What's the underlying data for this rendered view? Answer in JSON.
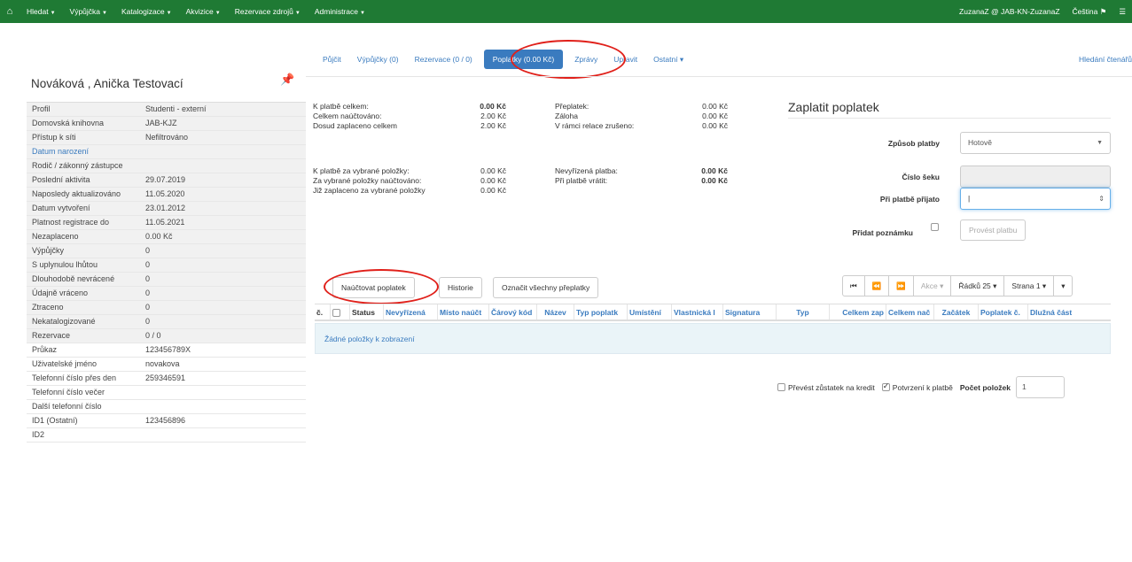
{
  "topnav": {
    "home_icon": "home-icon",
    "items": [
      "Hledat",
      "Výpůjčka",
      "Katalogizace",
      "Akvizice",
      "Rezervace zdrojů",
      "Administrace"
    ],
    "user": "ZuzanaZ @ JAB-KN-ZuzanaZ",
    "language": "Čeština",
    "menu_icon": "menu-icon"
  },
  "patron": {
    "name": "Nováková , Anička Testovací",
    "rows": [
      {
        "k": "Profil",
        "v": "Studenti - externí"
      },
      {
        "k": "Domovská knihovna",
        "v": "JAB-KJZ"
      },
      {
        "k": "Přístup k síti",
        "v": "Nefiltrováno"
      },
      {
        "k": "Datum narození",
        "v": ""
      },
      {
        "k": "Rodič / zákonný zástupce",
        "v": ""
      },
      {
        "k": "Poslední aktivita",
        "v": "29.07.2019"
      },
      {
        "k": "Naposledy aktualizováno",
        "v": "11.05.2020"
      },
      {
        "k": "Datum vytvoření",
        "v": "23.01.2012"
      },
      {
        "k": "Platnost registrace do",
        "v": "11.05.2021"
      },
      {
        "k": "Nezaplaceno",
        "v": "0.00 Kč"
      },
      {
        "k": "Výpůjčky",
        "v": "0"
      },
      {
        "k": "S uplynulou lhůtou",
        "v": "0"
      },
      {
        "k": "Dlouhodobě nevrácené",
        "v": "0"
      },
      {
        "k": "Údajně vráceno",
        "v": "0"
      },
      {
        "k": "Ztraceno",
        "v": "0"
      },
      {
        "k": "Nekatalogizované",
        "v": "0"
      },
      {
        "k": "Rezervace",
        "v": "0 / 0"
      },
      {
        "k": "Průkaz",
        "v": "123456789X"
      },
      {
        "k": "Uživatelské jméno",
        "v": "novakova"
      },
      {
        "k": "Telefonní číslo přes den",
        "v": "259346591"
      },
      {
        "k": "Telefonní číslo večer",
        "v": ""
      },
      {
        "k": "Další telefonní číslo",
        "v": ""
      },
      {
        "k": "ID1 (Ostatní)",
        "v": "123456896"
      },
      {
        "k": "ID2",
        "v": ""
      }
    ]
  },
  "tabs": {
    "items": [
      "Půjčit",
      "Výpůjčky (0)",
      "Rezervace (0 / 0)",
      "Poplatky (0.00 Kč)",
      "Zprávy",
      "Upravit",
      "Ostatní"
    ],
    "search": "Hledání čtenářů"
  },
  "summary": {
    "top_left": [
      {
        "lbl": "K platbě celkem:",
        "val": "0.00 Kč"
      },
      {
        "lbl": "Celkem naúčtováno:",
        "val": "2.00 Kč"
      },
      {
        "lbl": "Dosud zaplaceno celkem",
        "val": "2.00 Kč"
      }
    ],
    "top_right": [
      {
        "lbl": "Přeplatek:",
        "val": "0.00 Kč"
      },
      {
        "lbl": "Záloha",
        "val": "0.00 Kč"
      },
      {
        "lbl": "V rámci relace zrušeno:",
        "val": "0.00 Kč"
      }
    ],
    "bottom_left": [
      {
        "lbl": "K platbě za vybrané položky:",
        "val": "0.00 Kč"
      },
      {
        "lbl": "Za vybrané položky naúčtováno:",
        "val": "0.00 Kč"
      },
      {
        "lbl": "Již zaplaceno za vybrané položky",
        "val": "0.00 Kč"
      }
    ],
    "bottom_right": [
      {
        "lbl": "Nevyřízená platba:",
        "val": "0.00 Kč"
      },
      {
        "lbl": "Při platbě vrátit:",
        "val": "0.00 Kč"
      }
    ]
  },
  "pay": {
    "title": "Zaplatit poplatek",
    "method_label": "Způsob platby",
    "method_value": "Hotově",
    "check_label": "Číslo šeku",
    "received_label": "Při platbě přijato",
    "note_label": "Přidat poznámku",
    "submit": "Provést platbu"
  },
  "actions": {
    "charge": "Naúčtovat poplatek",
    "history": "Historie",
    "mark_overpaid": "Označit všechny přeplatky"
  },
  "toolbar": {
    "first": "⏮",
    "prev": "⏪",
    "next": "⏩",
    "actions": "Akce",
    "rows": "Řádků 25",
    "page": "Strana 1"
  },
  "table": {
    "headers": [
      "č.",
      "",
      "Status",
      "Nevyřízená",
      "Místo naúčt",
      "Čárový kód",
      "Název",
      "Typ poplatk",
      "Umístění",
      "Vlastnická l",
      "Signatura",
      "Typ",
      "Celkem zap",
      "Celkem nač",
      "Začátek",
      "Poplatek č.",
      "Dlužná část"
    ],
    "empty": "Žádné položky k zobrazení"
  },
  "footer": {
    "transfer": "Převést zůstatek na kredit",
    "confirm": "Potvrzení k platbě",
    "count_label": "Počet položek",
    "count_value": "1"
  }
}
